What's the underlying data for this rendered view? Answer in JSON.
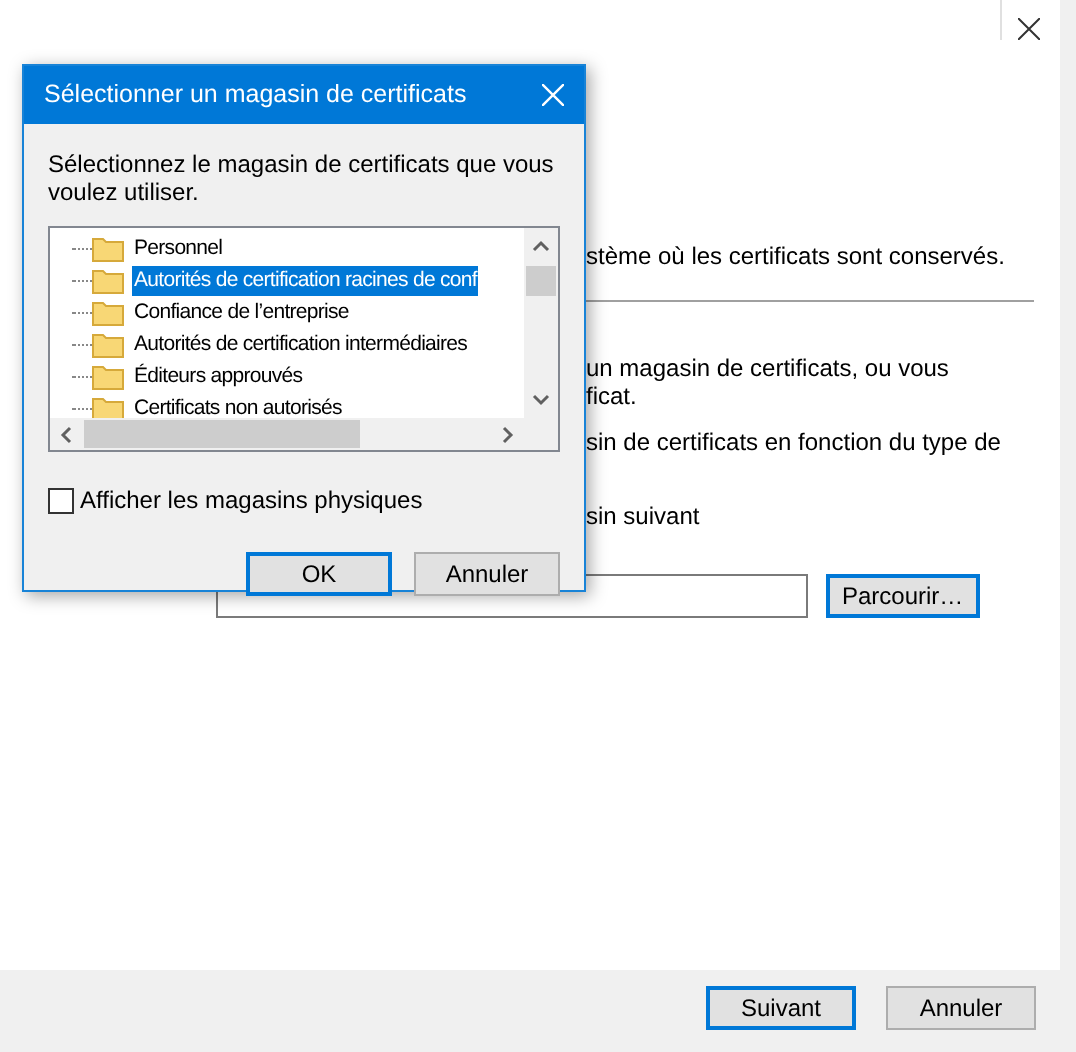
{
  "wizard": {
    "intro": "stème où les certificats sont conservés.",
    "option_lines": [
      "un magasin de certificats, ou vous",
      "ficat."
    ],
    "auto_line": "sin de certificats en fonction du type de",
    "manual_line": "sin suivant",
    "browse_button": "Parcourir…",
    "next_button": "Suivant",
    "cancel_button": "Annuler"
  },
  "dialog": {
    "title": "Sélectionner un magasin de certificats",
    "prompt": "Sélectionnez le magasin de certificats que vous voulez utiliser.",
    "stores": [
      {
        "label": "Personnel",
        "selected": false
      },
      {
        "label": "Autorités de certification racines de conf",
        "selected": true
      },
      {
        "label": "Confiance de l’entreprise",
        "selected": false
      },
      {
        "label": "Autorités de certification intermédiaires",
        "selected": false
      },
      {
        "label": "Éditeurs approuvés",
        "selected": false
      },
      {
        "label": "Certificats non autorisés",
        "selected": false
      }
    ],
    "show_physical": {
      "label": "Afficher les magasins physiques",
      "checked": false
    },
    "ok_button": "OK",
    "cancel_button": "Annuler"
  }
}
